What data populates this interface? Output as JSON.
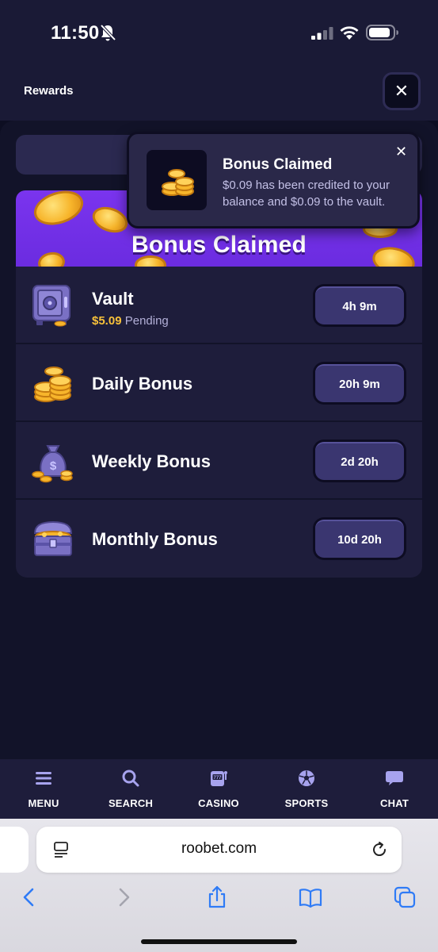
{
  "status_bar": {
    "time": "11:50",
    "icons": [
      "bell-slash-icon",
      "cellular-signal-icon",
      "wifi-icon",
      "battery-icon"
    ]
  },
  "header": {
    "title": "Rewards",
    "close_label": "✕"
  },
  "banner": {
    "title": "Bonus Claimed"
  },
  "rewards": [
    {
      "name": "Vault",
      "amount": "$5.09",
      "status": "Pending",
      "timer": "4h 9m",
      "icon": "vault-safe-icon"
    },
    {
      "name": "Daily Bonus",
      "timer": "20h 9m",
      "icon": "coin-stack-icon"
    },
    {
      "name": "Weekly Bonus",
      "timer": "2d 20h",
      "icon": "money-bag-icon"
    },
    {
      "name": "Monthly Bonus",
      "timer": "10d 20h",
      "icon": "treasure-chest-icon"
    }
  ],
  "toast": {
    "title": "Bonus Claimed",
    "message": "$0.09 has been credited to your balance and $0.09 to the vault.",
    "close_label": "✕",
    "icon": "coin-stack-icon"
  },
  "bottom_nav": [
    {
      "label": "MENU",
      "icon": "hamburger-menu-icon"
    },
    {
      "label": "SEARCH",
      "icon": "search-icon"
    },
    {
      "label": "CASINO",
      "icon": "slot-machine-icon"
    },
    {
      "label": "SPORTS",
      "icon": "soccer-ball-icon"
    },
    {
      "label": "CHAT",
      "icon": "chat-bubble-icon"
    }
  ],
  "browser": {
    "url": "roobet.com",
    "buttons": [
      "back-icon",
      "forward-icon",
      "share-icon",
      "bookmarks-icon",
      "tabs-icon"
    ]
  },
  "colors": {
    "background": "#0d0e22",
    "panel": "#1e1d3b",
    "banner_purple": "#6b2ce0",
    "accent_gold": "#f8c13a",
    "timer_button": "#3a3670"
  }
}
